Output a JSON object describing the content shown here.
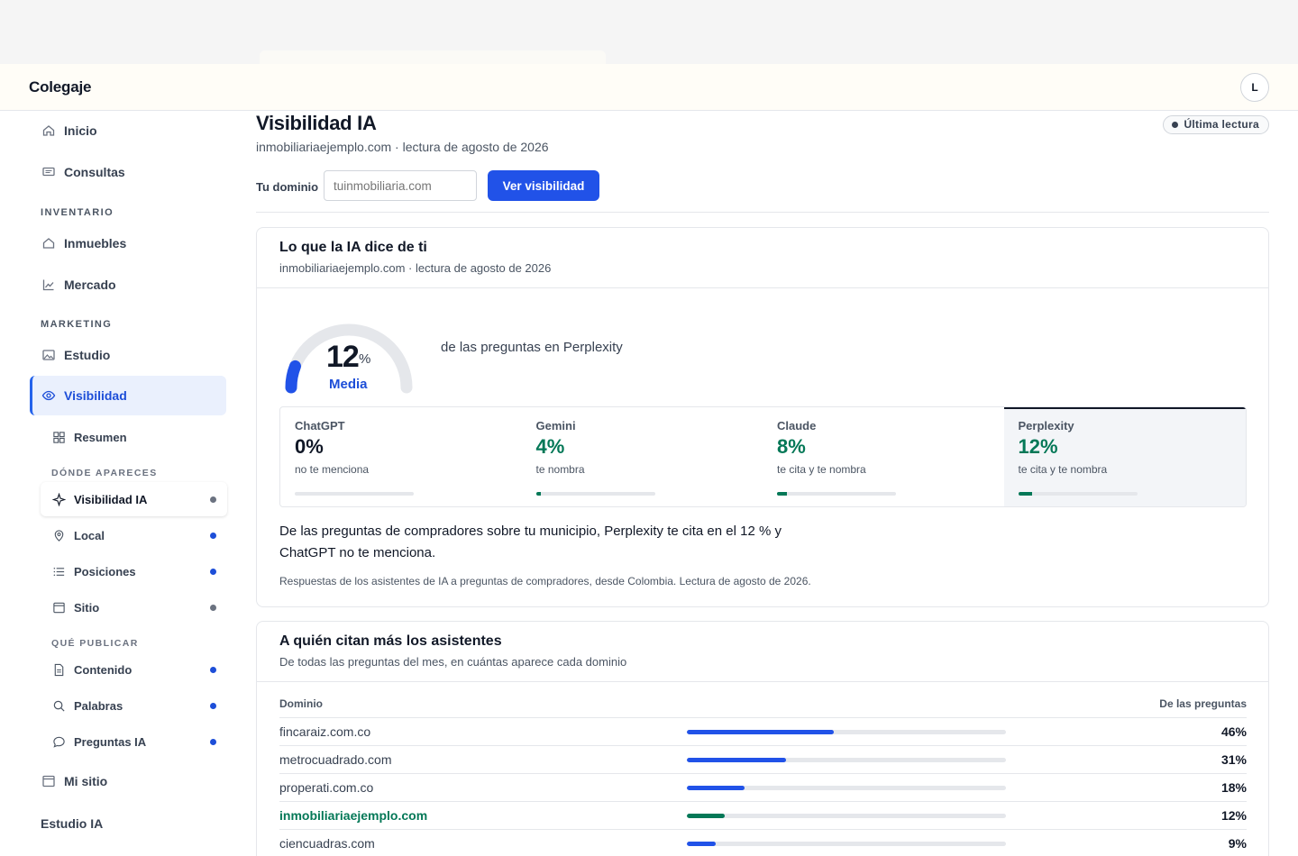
{
  "app": {
    "brand": "Colegaje",
    "avatar_initial": "L"
  },
  "sidebar": {
    "inicio": "Inicio",
    "consultas": "Consultas",
    "section_inventario": "INVENTARIO",
    "inmuebles": "Inmuebles",
    "mercado": "Mercado",
    "section_marketing": "MARKETING",
    "estudio": "Estudio",
    "visibilidad": "Visibilidad",
    "resumen": "Resumen",
    "section_donde": "DÓNDE APARECES",
    "visibilidad_ia": "Visibilidad IA",
    "local": "Local",
    "posiciones": "Posiciones",
    "sitio": "Sitio",
    "section_que": "QUÉ PUBLICAR",
    "contenido": "Contenido",
    "palabras": "Palabras",
    "preguntas_ia": "Preguntas IA",
    "mi_sitio": "Mi sitio",
    "estudio_ia": "Estudio IA"
  },
  "page": {
    "title": "Visibilidad IA",
    "subtitle": "inmobiliariaejemplo.com · lectura de agosto de 2026",
    "badge": "Última lectura",
    "domain_label": "Tu dominio",
    "domain_placeholder": "tuinmobiliaria.com",
    "domain_button": "Ver visibilidad"
  },
  "card_ai": {
    "title": "Lo que la IA dice de ti",
    "subtitle": "inmobiliariaejemplo.com · lectura de agosto de 2026",
    "gauge_value": "12",
    "gauge_value_num": 12,
    "gauge_unit": "%",
    "gauge_label": "Media",
    "gauge_desc": "de las preguntas en Perplexity",
    "engines": [
      {
        "name": "ChatGPT",
        "value": "0%",
        "pct": 0,
        "note": "no te menciona",
        "color": "#111827"
      },
      {
        "name": "Gemini",
        "value": "4%",
        "pct": 4,
        "note": "te nombra",
        "color": "#047857"
      },
      {
        "name": "Claude",
        "value": "8%",
        "pct": 8,
        "note": "te cita y te nombra",
        "color": "#047857"
      },
      {
        "name": "Perplexity",
        "value": "12%",
        "pct": 12,
        "note": "te cita y te nombra",
        "color": "#047857"
      }
    ],
    "summary": "De las preguntas de compradores sobre tu municipio, Perplexity te cita en el 12 % y ChatGPT no te menciona.",
    "footnote": "Respuestas de los asistentes de IA a preguntas de compradores, desde Colombia. Lectura de agosto de 2026."
  },
  "card_cites": {
    "title": "A quién citan más los asistentes",
    "subtitle": "De todas las preguntas del mes, en cuántas aparece cada dominio",
    "col_domain": "Dominio",
    "col_share": "De las preguntas",
    "rows": [
      {
        "domain": "fincaraiz.com.co",
        "value": "46%",
        "pct": 46,
        "own": false
      },
      {
        "domain": "metrocuadrado.com",
        "value": "31%",
        "pct": 31,
        "own": false
      },
      {
        "domain": "properati.com.co",
        "value": "18%",
        "pct": 18,
        "own": false
      },
      {
        "domain": "inmobiliariaejemplo.com",
        "value": "12%",
        "pct": 12,
        "own": true
      },
      {
        "domain": "ciencuadras.com",
        "value": "9%",
        "pct": 9,
        "own": false
      }
    ]
  },
  "colors": {
    "accent": "#2152e8",
    "good": "#047857",
    "active_bg": "#eaf0fd"
  }
}
